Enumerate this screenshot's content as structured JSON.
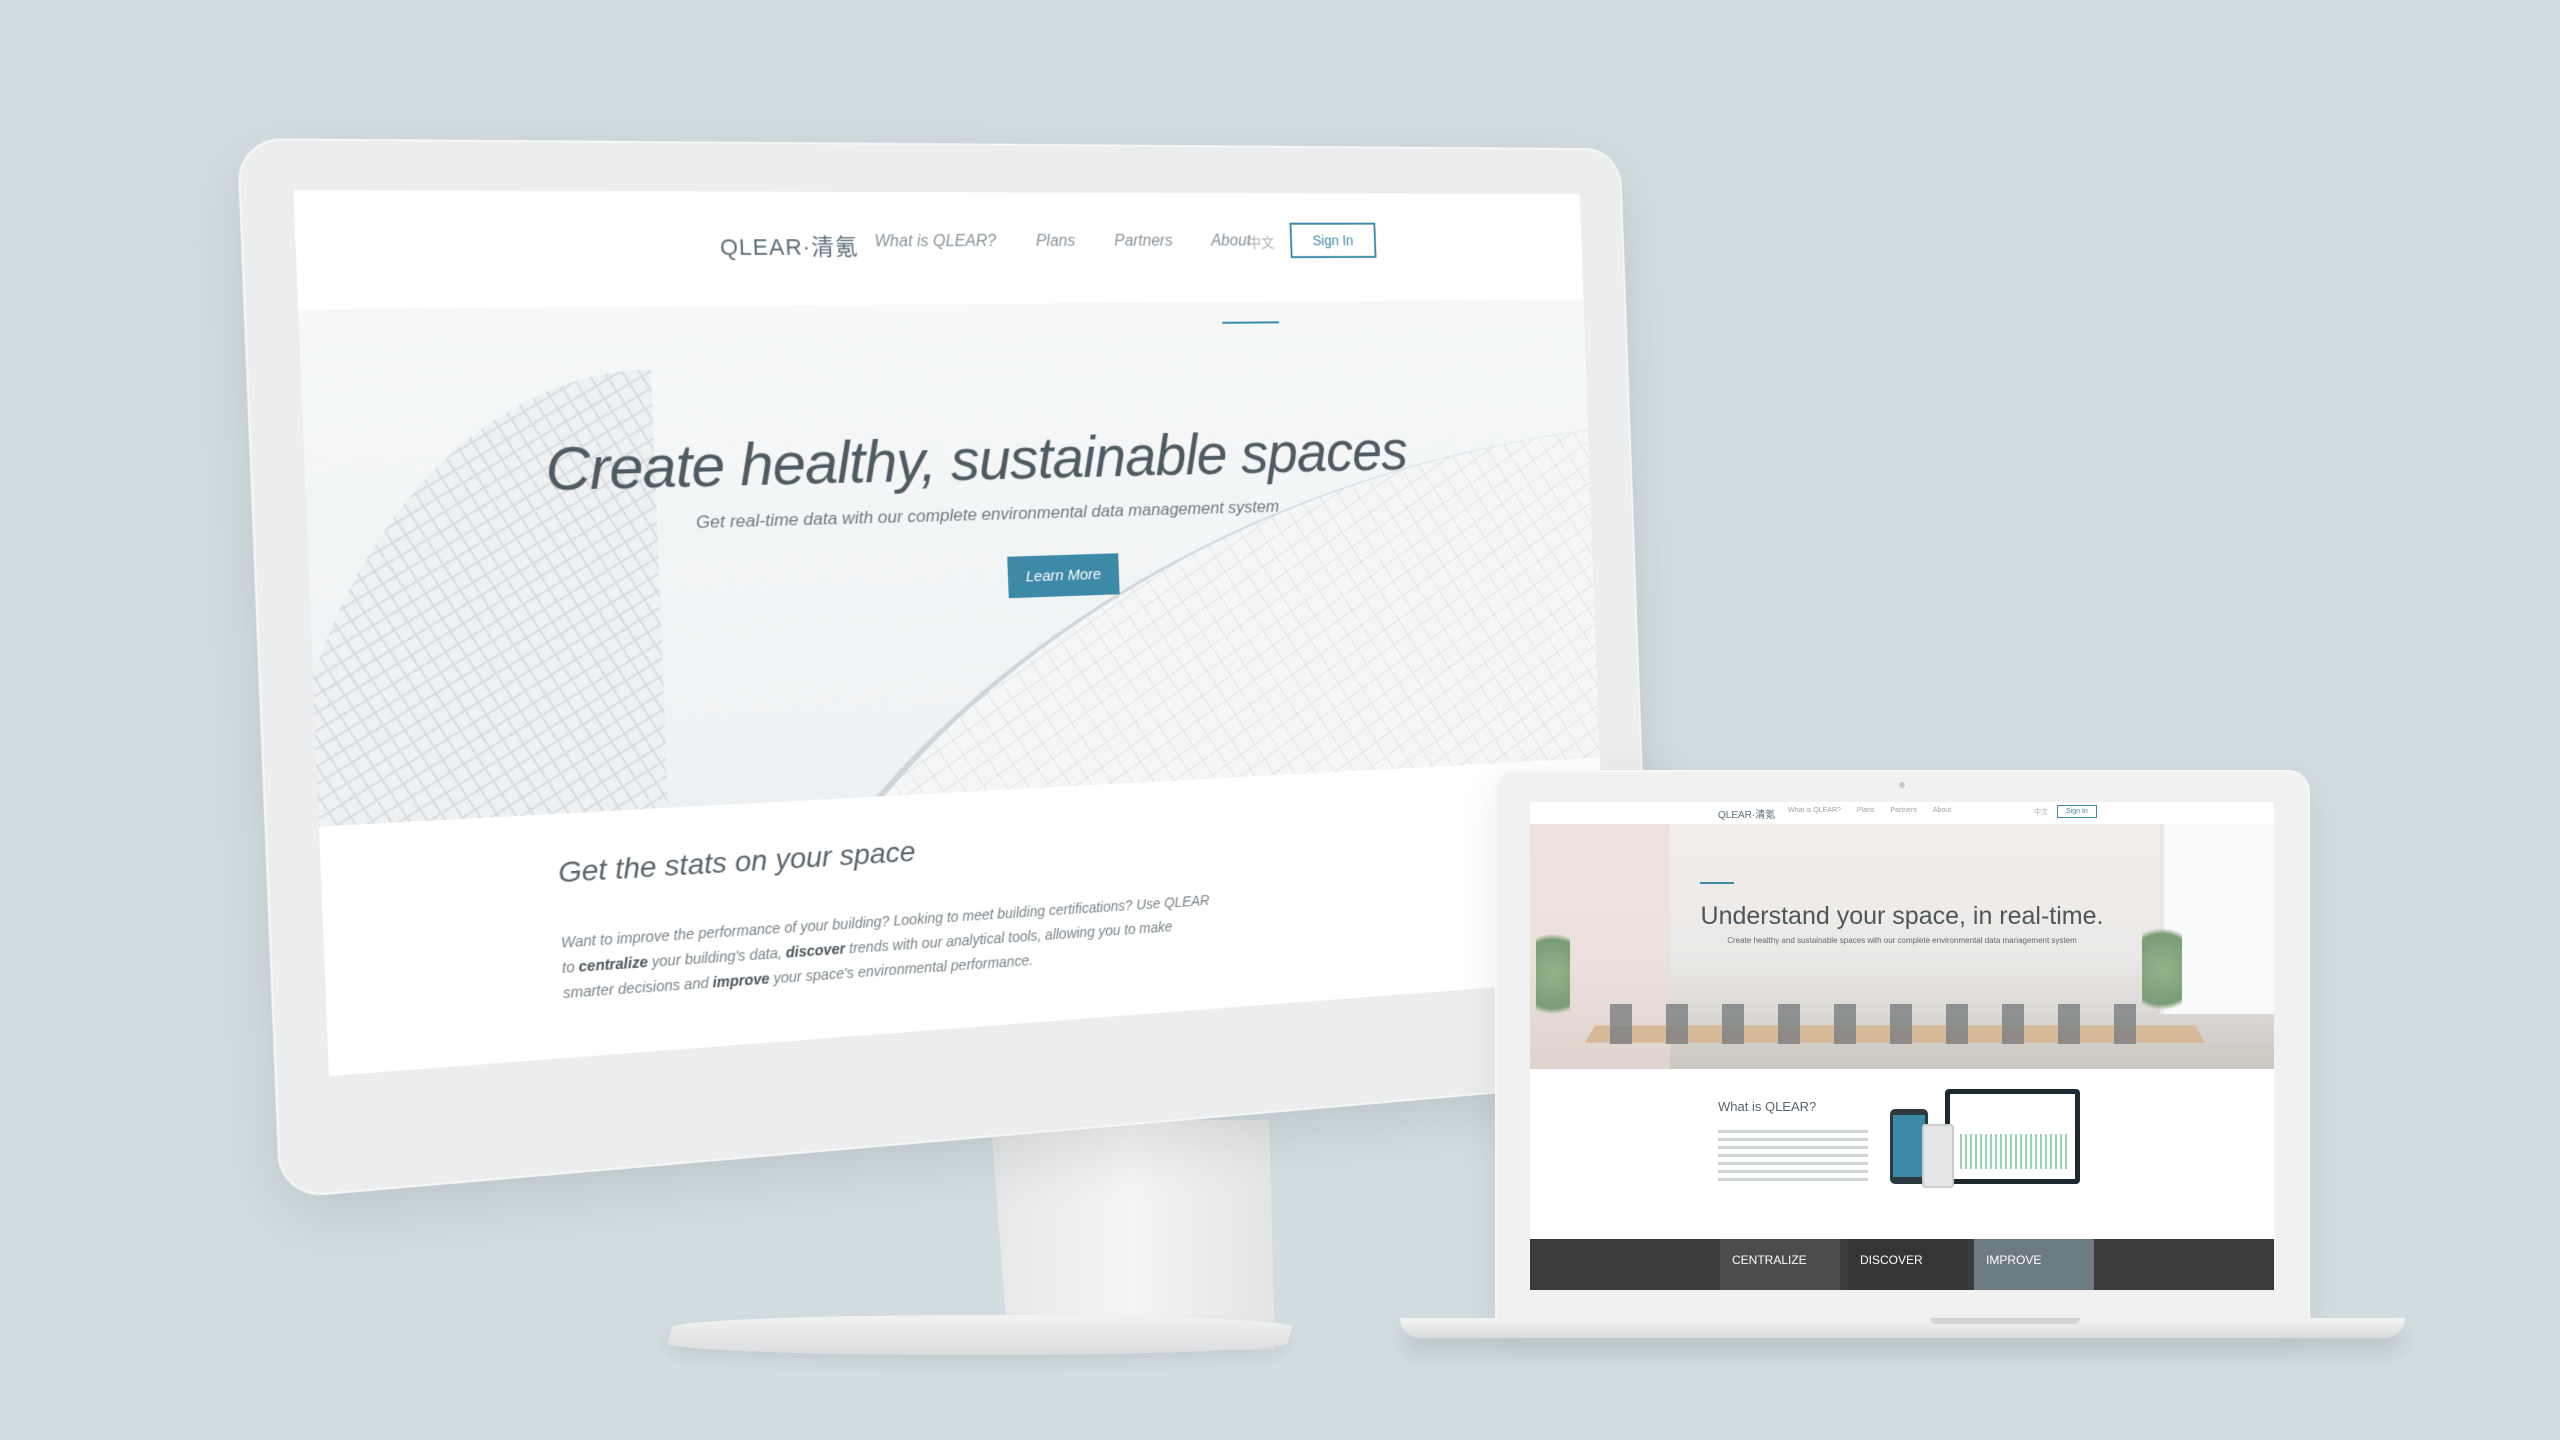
{
  "desktop": {
    "nav": {
      "logo": "QLEAR·清氪",
      "links": [
        "What is QLEAR?",
        "Plans",
        "Partners",
        "About"
      ],
      "language": "中文",
      "signin_label": "Sign In"
    },
    "hero": {
      "title": "Create healthy, sustainable spaces",
      "subtitle": "Get real-time data with our complete environmental data management system",
      "cta_label": "Learn More"
    },
    "section": {
      "title": "Get the stats on your space",
      "body_1": "Want to improve the performance of your building? Looking to meet building certifications? Use QLEAR to ",
      "body_centralize": "centralize",
      "body_2": " your building's data, ",
      "body_discover": "discover",
      "body_3": " trends with our analytical tools, allowing you to make smarter decisions and ",
      "body_improve": "improve",
      "body_4": " your space's environmental performance."
    }
  },
  "laptop": {
    "nav": {
      "logo": "QLEAR·清氪",
      "links": [
        "What is QLEAR?",
        "Plans",
        "Partners",
        "About"
      ],
      "language": "中文",
      "signin_label": "Sign In"
    },
    "hero": {
      "title": "Understand your space, in real-time.",
      "subtitle": "Create healthy and sustainable spaces with our complete environmental data management system"
    },
    "what": {
      "title": "What is QLEAR?"
    },
    "tabs": [
      "CENTRALIZE",
      "DISCOVER",
      "IMPROVE"
    ]
  },
  "colors": {
    "background": "#d1dde1",
    "accent": "#3c89a8"
  }
}
